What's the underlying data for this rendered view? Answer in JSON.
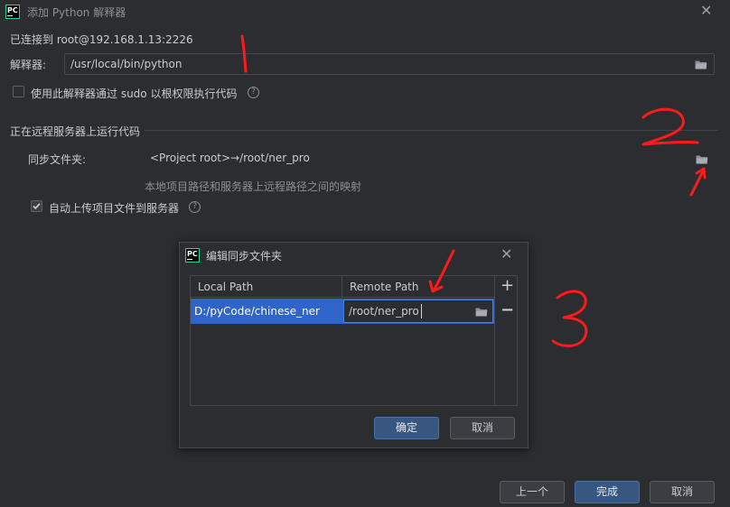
{
  "window": {
    "title": "添加 Python 解释器",
    "connected": "已连接到 root@192.168.1.13:2226",
    "interpreter_label": "解释器:",
    "interpreter_value": "/usr/local/bin/python",
    "sudo_label": "使用此解释器通过 sudo 以根权限执行代码",
    "section_title": "正在远程服务器上运行代码",
    "sync_label": "同步文件夹:",
    "sync_value": "<Project root>→/root/ner_pro",
    "sync_hint": "本地项目路径和服务器上远程路径之间的映射",
    "auto_upload_label": "自动上传项目文件到服务器",
    "prev_button": "上一个",
    "finish_button": "完成",
    "cancel_button": "取消"
  },
  "dialog": {
    "title": "编辑同步文件夹",
    "columns": [
      "Local Path",
      "Remote Path"
    ],
    "rows": [
      {
        "local": "D:/pyCode/chinese_ner",
        "remote": "/root/ner_pro"
      }
    ],
    "add_symbol": "+",
    "remove_symbol": "−",
    "ok_button": "确定",
    "cancel_button": "取消"
  },
  "colors": {
    "background": "#2b2d30",
    "selection": "#2f65ca",
    "accent": "#365880",
    "annotation": "#ff1a1a"
  },
  "icons": [
    "pycharm-logo-icon",
    "close-icon",
    "folder-icon",
    "help-icon",
    "check-icon"
  ]
}
